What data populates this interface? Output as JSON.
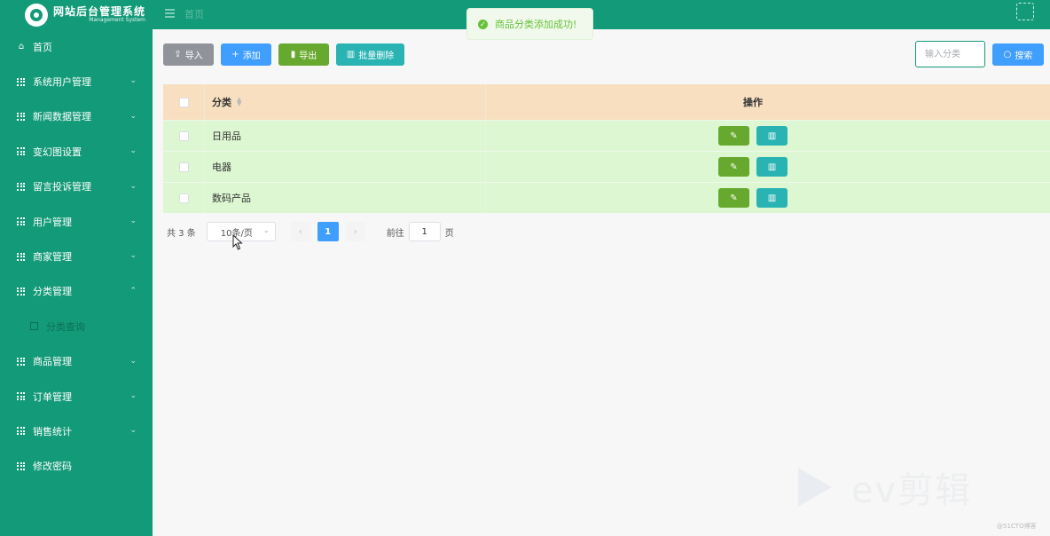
{
  "brand": {
    "title": "网站后台管理系统",
    "subtitle": "Management System"
  },
  "header": {
    "breadcrumb": "首页"
  },
  "toast": {
    "message": "商品分类添加成功!",
    "icon": "check-circle-icon",
    "color": "#67c23a"
  },
  "sidebar": {
    "items": [
      {
        "label": "首页",
        "icon": "home-icon",
        "chevron": ""
      },
      {
        "label": "系统用户管理",
        "icon": "grid-icon",
        "chevron": "⌄"
      },
      {
        "label": "新闻数据管理",
        "icon": "grid-icon",
        "chevron": "⌄"
      },
      {
        "label": "变幻图设置",
        "icon": "grid-icon",
        "chevron": "⌄"
      },
      {
        "label": "留言投诉管理",
        "icon": "grid-icon",
        "chevron": "⌄"
      },
      {
        "label": "用户管理",
        "icon": "grid-icon",
        "chevron": "⌄"
      },
      {
        "label": "商家管理",
        "icon": "grid-icon",
        "chevron": "⌄"
      },
      {
        "label": "分类管理",
        "icon": "grid-icon",
        "chevron": "⌃"
      },
      {
        "label": "商品管理",
        "icon": "grid-icon",
        "chevron": "⌄"
      },
      {
        "label": "订单管理",
        "icon": "grid-icon",
        "chevron": "⌄"
      },
      {
        "label": "销售统计",
        "icon": "grid-icon",
        "chevron": "⌄"
      },
      {
        "label": "修改密码",
        "icon": "grid-icon",
        "chevron": ""
      }
    ],
    "sub_item": {
      "label": "分类查询",
      "icon": "document-icon"
    }
  },
  "toolbar": {
    "import_label": "导入",
    "add_label": "添加",
    "export_label": "导出",
    "batch_delete_label": "批量删除",
    "search_placeholder": "输入分类",
    "search_label": "搜索"
  },
  "table": {
    "columns": {
      "category": "分类",
      "actions": "操作"
    },
    "rows": [
      {
        "category": "日用品"
      },
      {
        "category": "电器"
      },
      {
        "category": "数码产品"
      }
    ]
  },
  "pagination": {
    "total_text": "共 3 条",
    "page_size": "10条/页",
    "current_page": "1",
    "goto_label": "前往",
    "goto_value": "1",
    "page_suffix": "页"
  },
  "watermark": {
    "text": "ev剪辑",
    "credit": "@51CTO博客"
  },
  "colors": {
    "brand": "#139a78",
    "primary": "#409eff",
    "success": "#67a92e",
    "info": "#29b3b3",
    "header_row": "#f7dfbf",
    "body_row": "#dcf7d2"
  }
}
